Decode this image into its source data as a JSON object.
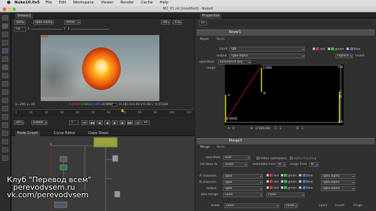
{
  "menubar": {
    "apple": "",
    "app": "Nuke10.0v5",
    "items": [
      "File",
      "Edit",
      "Workspace",
      "Viewer",
      "Render",
      "Cache",
      "Help"
    ]
  },
  "window_title": "M2_01.nk [modified] - NukeX",
  "viewer": {
    "tab": "Viewer1",
    "channel": "rgba",
    "layer": "rgba.alpha",
    "colorspace": "sRGB",
    "proxy": "2D",
    "zoom": "1:1",
    "frame_field": "f/8",
    "frame_value": "1",
    "y_label": "Y",
    "y_value": "1",
    "status_coords": "x=290 y=16",
    "status_vals": [
      "0.0000",
      "0.0852",
      "0.0852",
      "0.9996"
    ],
    "status_hsvl": "H:183 S:0.04 V:0.08  L: 0.07348",
    "timeline_ticks": [
      "1",
      "10",
      "20",
      "30",
      "40",
      "50",
      "60",
      "70",
      "80",
      "90",
      "100",
      "107"
    ],
    "fps": "24*",
    "global": "Global",
    "frame_now": "1",
    "playback": "10"
  },
  "node_panel": {
    "tabs": [
      "Node Graph",
      "Curve Editor",
      "Dope Sheet"
    ]
  },
  "properties": {
    "title": "Properties",
    "count": "10",
    "keyer": {
      "name": "Keyer1",
      "tabs": [
        "Keyer",
        "Node"
      ],
      "input_label": "input",
      "input_value": "rgb",
      "output_label": "output",
      "output_value": "rgba.alpha",
      "operation_label": "operation",
      "operation_value": "luminance key",
      "range_label": "range",
      "channels": [
        "red",
        "green",
        "blue"
      ],
      "replace": "replace",
      "invert": "invert",
      "graph": {
        "top_val": "0.089",
        "bottom_left": "0.0000",
        "right_top": "1.0",
        "right_bottom": "1.0",
        "marker_a": "A",
        "marker_b": "B",
        "marker_c": "C",
        "marker_d": "D",
        "labels": [
          "A",
          "0",
          "B",
          "0.089398",
          "C",
          "1",
          "D",
          "1"
        ]
      }
    },
    "merge": {
      "name": "Merge3",
      "tabs": [
        "Merge",
        "Node"
      ],
      "operation_label": "operation",
      "operation_value": "over",
      "video_cs": "Video colorspace",
      "alpha_masking": "alpha masking",
      "bbox_label": "set bbox to",
      "bbox_value": "union",
      "metadata_label": "metadata from",
      "metadata_value": "B",
      "range_label": "range from",
      "range_value": "B",
      "a_channels_label": "A channels",
      "a_channels_value": "rgba",
      "b_channels_label": "B channels",
      "b_channels_value": "rgba",
      "output_label": "output",
      "output_value": "rgba",
      "also_merge_label": "also merge",
      "also_merge_value": "none",
      "mask_label": "mask",
      "mask_value": "none",
      "channel_names": [
        "red",
        "green",
        "blue"
      ],
      "alpha_value": "rgba.alpha",
      "inject": "inject",
      "invert": "invert",
      "fringe": "fringe"
    }
  },
  "watermark": {
    "line1": "Клуб \"Перевод всем\"",
    "line2": "perevodvsem.ru",
    "line3": "vk.com/perevodvsem"
  }
}
